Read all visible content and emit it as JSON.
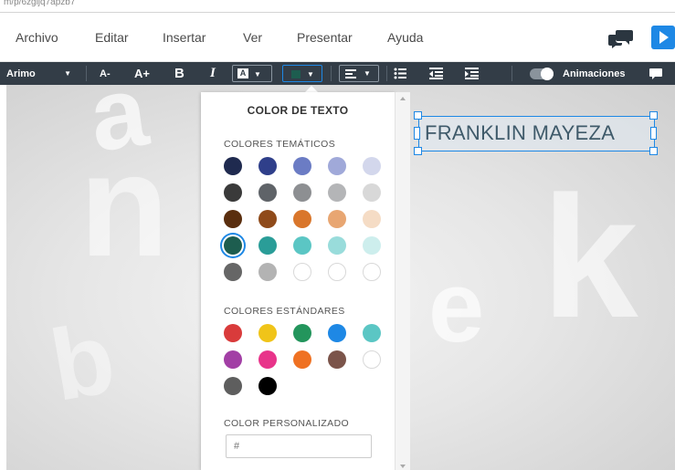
{
  "browser": {
    "url_fragment": "m/p/6zgljq7apzb7"
  },
  "menu": {
    "items": [
      "Archivo",
      "Editar",
      "Insertar",
      "Ver",
      "Presentar",
      "Ayuda"
    ]
  },
  "toolbar": {
    "font": "Arimo",
    "decrease_font": "A-",
    "increase_font": "A+",
    "bold": "B",
    "italic": "I",
    "highlight_letter": "A",
    "text_color": "#1d5d4f",
    "animations_label": "Animaciones"
  },
  "slide": {
    "text": "FRANKLIN MAYEZA",
    "background_letters": [
      "a",
      "n",
      "b",
      "e",
      "k"
    ]
  },
  "color_panel": {
    "title": "COLOR DE TEXTO",
    "theme_label": "COLORES TEMÁTICOS",
    "standard_label": "COLORES ESTÁNDARES",
    "custom_label": "COLOR PERSONALIZADO",
    "custom_placeholder": "#",
    "theme_colors": [
      [
        "#1f2a4f",
        "#2f3f8a",
        "#6b7cc4",
        "#a0a9d9",
        "#d3d7ec"
      ],
      [
        "#3a3a3a",
        "#5f6368",
        "#8d8f92",
        "#b4b5b7",
        "#d8d8d8"
      ],
      [
        "#5a2e0e",
        "#8f4a1a",
        "#d9762b",
        "#e8a672",
        "#f5dcc5"
      ],
      [
        "#1d5d4f",
        "#2a9d98",
        "#5bc6c4",
        "#99dcdb",
        "#cdeeed"
      ],
      [
        "#666666",
        "#b3b3b3",
        "#ffffff",
        "#ffffff",
        "#ffffff"
      ]
    ],
    "selected_theme": "#1d5d4f",
    "standard_colors": [
      [
        "#d93b3b",
        "#f0c419",
        "#23955c",
        "#1e88e5",
        "#5bc6c4"
      ],
      [
        "#a23fa5",
        "#e8348a",
        "#ef7122",
        "#7b544a",
        "#ffffff"
      ],
      [
        "#5e5e5e",
        "#000000"
      ]
    ]
  }
}
